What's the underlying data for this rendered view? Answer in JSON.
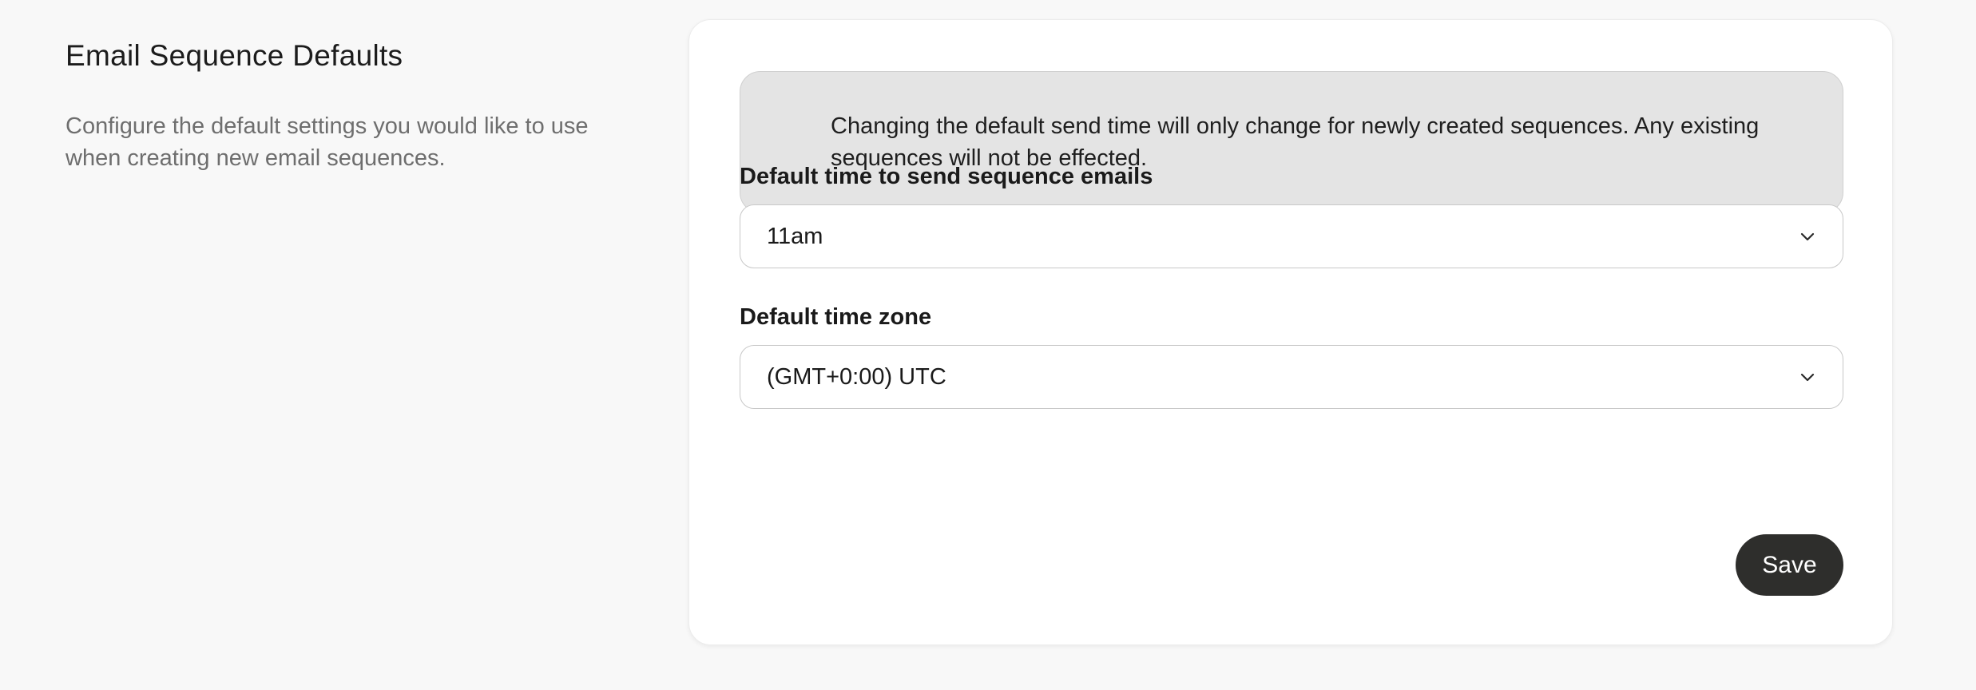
{
  "section": {
    "title": "Email Sequence Defaults",
    "description": "Configure the default settings you would like to use when creating new email sequences."
  },
  "notice": {
    "icon": "info-icon",
    "text": "Changing the default send time will only change for newly created sequences. Any existing sequences will not be effected."
  },
  "fields": {
    "send_time": {
      "label": "Default time to send sequence emails",
      "value": "11am"
    },
    "time_zone": {
      "label": "Default time zone",
      "value": "(GMT+0:00) UTC"
    }
  },
  "actions": {
    "save_label": "Save"
  },
  "colors": {
    "background": "#f8f8f8",
    "card": "#ffffff",
    "notice_bg": "#e4e4e4",
    "button_bg": "#2e2e2c",
    "muted_text": "#6e6e6e"
  }
}
